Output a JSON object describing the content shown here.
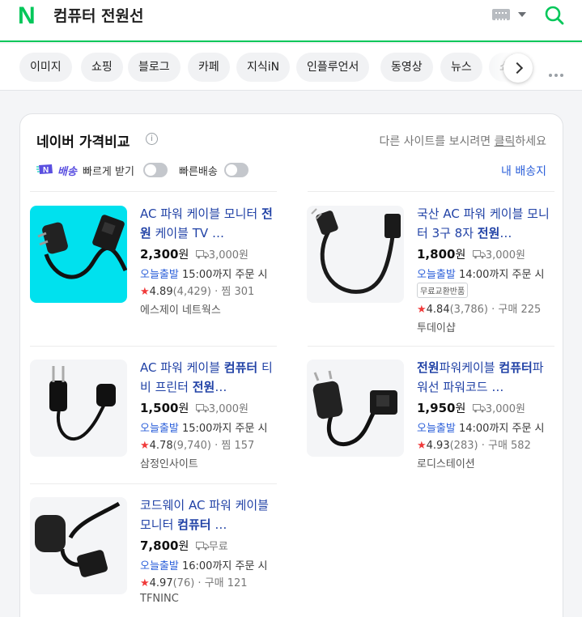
{
  "header": {
    "logo": "N",
    "query": "컴퓨터 전원선",
    "brand_color": "#03c75a"
  },
  "tabs": [
    "이미지",
    "쇼핑",
    "블로그",
    "카페",
    "지식iN",
    "인플루언서",
    "동영상",
    "뉴스",
    "쇼"
  ],
  "card": {
    "title": "네이버 가격비교",
    "info_icon": "i",
    "other_site_prefix": "다른 사이트를 보시려면 ",
    "other_site_link": "클릭",
    "other_site_suffix": "하세요",
    "baesong_badge": "N",
    "baesong_label": "배송",
    "fast_receive": "빠르게 받기",
    "fast_delivery": "빠른배송",
    "my_address": "내 배송지"
  },
  "products": [
    {
      "title_parts": [
        [
          "AC 파워 케이블 모니터 ",
          false
        ],
        [
          "전원",
          true
        ],
        [
          " 케이블 TV …",
          false
        ]
      ],
      "price": "2,300",
      "won": "원",
      "shipping": "3,000원",
      "today": "오늘출발",
      "cutoff": "15:00까지 주문 시",
      "score": "4.89",
      "reviews": "(4,429)",
      "extra": "찜 301",
      "seller": "에스제이 네트웍스",
      "tag": ""
    },
    {
      "title_parts": [
        [
          "국산 AC 파워 케이블 모니터 3구 8자 ",
          false
        ],
        [
          "전원",
          true
        ],
        [
          "…",
          false
        ]
      ],
      "price": "1,800",
      "won": "원",
      "shipping": "3,000원",
      "today": "오늘출발",
      "cutoff": "14:00까지 주문 시",
      "score": "4.84",
      "reviews": "(3,786)",
      "extra": "구매 225",
      "seller": "투데이샵",
      "tag": "무료교환반품"
    },
    {
      "title_parts": [
        [
          "AC 파워 케이블 ",
          false
        ],
        [
          "컴퓨터",
          true
        ],
        [
          " 티비 프린터 ",
          false
        ],
        [
          "전원",
          true
        ],
        [
          "…",
          false
        ]
      ],
      "price": "1,500",
      "won": "원",
      "shipping": "3,000원",
      "today": "오늘출발",
      "cutoff": "15:00까지 주문 시",
      "score": "4.78",
      "reviews": "(9,740)",
      "extra": "찜 157",
      "seller": "삼정인사이트",
      "tag": ""
    },
    {
      "title_parts": [
        [
          "전원",
          true
        ],
        [
          "파워케이블 ",
          false
        ],
        [
          "컴퓨터",
          true
        ],
        [
          "파워선 파워코드 …",
          false
        ]
      ],
      "price": "1,950",
      "won": "원",
      "shipping": "3,000원",
      "today": "오늘출발",
      "cutoff": "14:00까지 주문 시",
      "score": "4.93",
      "reviews": "(283)",
      "extra": "구매 582",
      "seller": "로디스테이션",
      "tag": ""
    },
    {
      "title_parts": [
        [
          "코드웨이 AC 파워 케이블 모니터 ",
          false
        ],
        [
          "컴퓨터",
          true
        ],
        [
          " …",
          false
        ]
      ],
      "price": "7,800",
      "won": "원",
      "shipping": "무료",
      "today": "오늘출발",
      "cutoff": "16:00까지 주문 시",
      "score": "4.97",
      "reviews": "(76)",
      "extra": "구매 121",
      "seller": "TFNINC",
      "tag": ""
    }
  ]
}
